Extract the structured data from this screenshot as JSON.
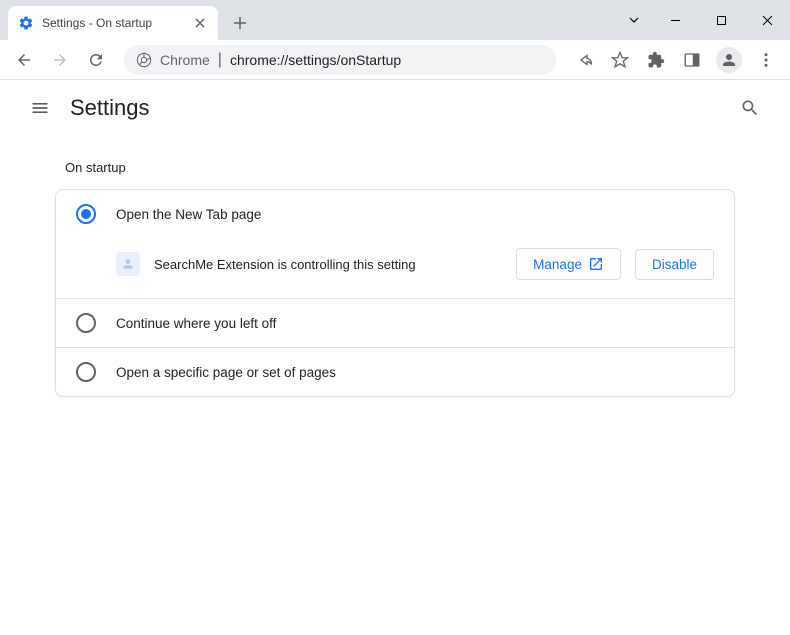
{
  "tab": {
    "title": "Settings - On startup"
  },
  "addressbar": {
    "chrome": "Chrome",
    "path": "chrome://settings/onStartup"
  },
  "header": {
    "title": "Settings"
  },
  "section": {
    "title": "On startup"
  },
  "options": {
    "new_tab": "Open the New Tab page",
    "continue": "Continue where you left off",
    "specific": "Open a specific page or set of pages"
  },
  "extension": {
    "notice": "SearchMe Extension is controlling this setting",
    "manage": "Manage",
    "disable": "Disable"
  }
}
